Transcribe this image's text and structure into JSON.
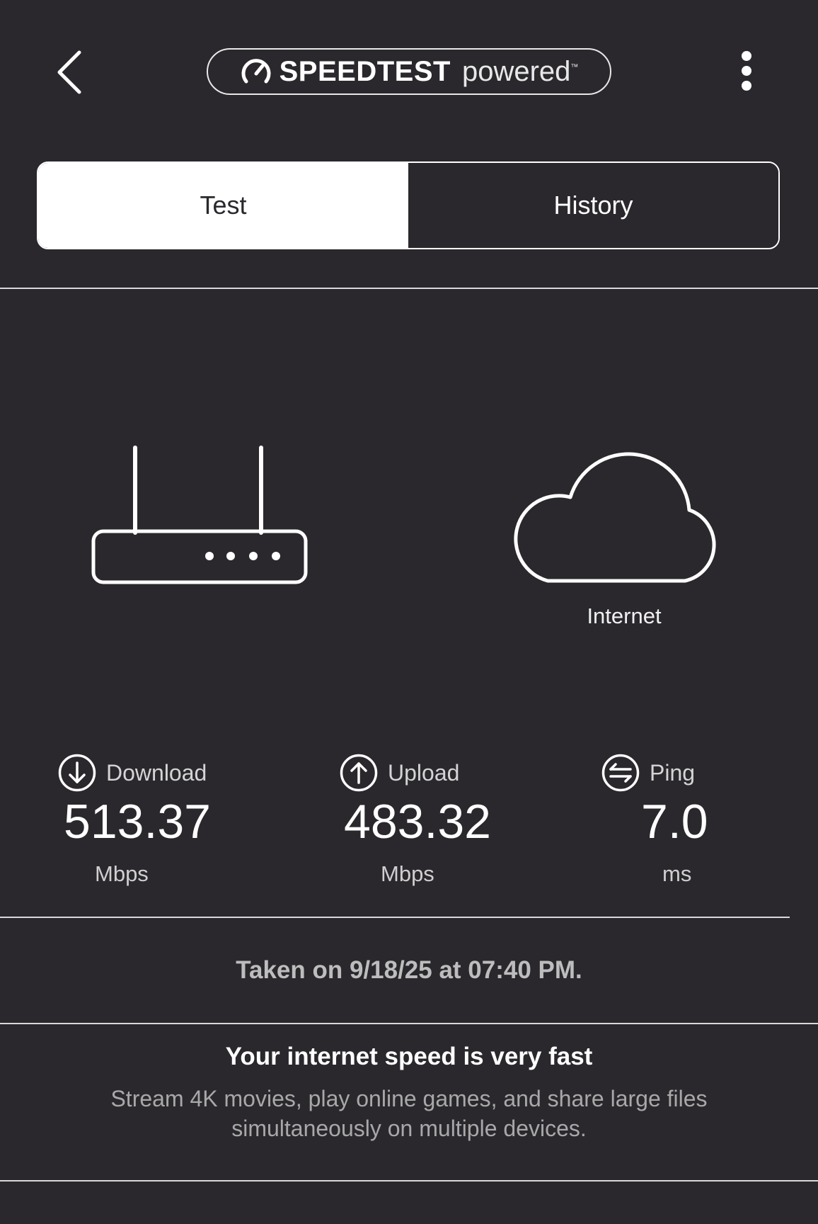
{
  "header": {
    "brand_word": "SPEEDTEST",
    "brand_sub": "powered",
    "brand_tm": "™",
    "icons": {
      "back": "chevron-left-icon",
      "brand": "speed-gauge-icon",
      "menu": "more-vertical-icon"
    }
  },
  "tabs": [
    {
      "label": "Test",
      "active": true
    },
    {
      "label": "History",
      "active": false
    }
  ],
  "illustration": {
    "router_icon": "router-icon",
    "cloud_icon": "cloud-icon",
    "internet_label": "Internet"
  },
  "metrics": {
    "download": {
      "label": "Download",
      "value": "513.37",
      "unit": "Mbps",
      "icon": "download-arrow-icon"
    },
    "upload": {
      "label": "Upload",
      "value": "483.32",
      "unit": "Mbps",
      "icon": "upload-arrow-icon"
    },
    "ping": {
      "label": "Ping",
      "value": "7.0",
      "unit": "ms",
      "icon": "ping-icon"
    }
  },
  "taken": "Taken on 9/18/25 at 07:40 PM.",
  "verdict": {
    "title": "Your internet speed is very fast",
    "body": "Stream 4K movies, play online games, and share large files simultaneously on multiple devices."
  },
  "colors": {
    "background": "#2a282d",
    "foreground": "#ffffff",
    "muted": "#a8a8a8"
  }
}
